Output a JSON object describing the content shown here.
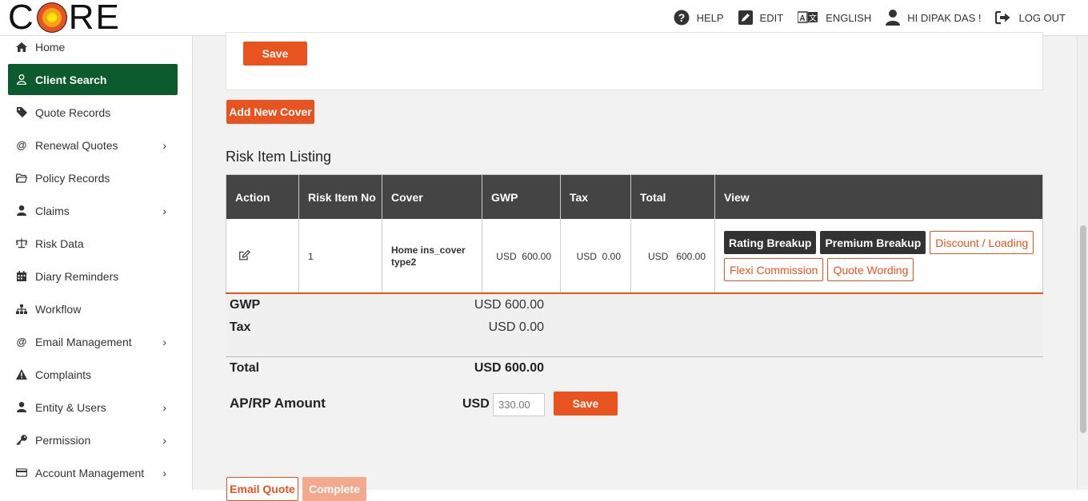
{
  "logo": {
    "text_c": "C",
    "text_re": "RE"
  },
  "topnav": {
    "help": "HELP",
    "edit": "EDIT",
    "language": "ENGLISH",
    "user": "HI DIPAK DAS !",
    "logout": "LOG OUT"
  },
  "sidebar": {
    "items": [
      {
        "label": "Home",
        "icon": "home-icon"
      },
      {
        "label": "Client Search",
        "icon": "user-icon",
        "active": true
      },
      {
        "label": "Quote Records",
        "icon": "tag-icon"
      },
      {
        "label": "Renewal Quotes",
        "icon": "at-icon",
        "submenu": true
      },
      {
        "label": "Policy Records",
        "icon": "folder-icon"
      },
      {
        "label": "Claims",
        "icon": "person-icon",
        "submenu": true
      },
      {
        "label": "Risk Data",
        "icon": "scale-icon"
      },
      {
        "label": "Diary Reminders",
        "icon": "calendar-icon"
      },
      {
        "label": "Workflow",
        "icon": "sitemap-icon"
      },
      {
        "label": "Email Management",
        "icon": "at-icon",
        "submenu": true
      },
      {
        "label": "Complaints",
        "icon": "warning-icon"
      },
      {
        "label": "Entity & Users",
        "icon": "person-icon",
        "submenu": true
      },
      {
        "label": "Permission",
        "icon": "key-icon",
        "submenu": true
      },
      {
        "label": "Account Management",
        "icon": "card-icon",
        "submenu": true
      }
    ],
    "chevron": "›"
  },
  "main": {
    "panel_save": "Save",
    "add_new_cover": "Add New Cover",
    "section_title": "Risk Item Listing",
    "table": {
      "headers": [
        "Action",
        "Risk Item No",
        "Cover",
        "GWP",
        "Tax",
        "Total",
        "View"
      ],
      "row": {
        "risk_item_no": "1",
        "cover": "Home ins_cover type2",
        "gwp": "USD  600.00",
        "tax": "USD  0.00",
        "total": "USD   600.00"
      },
      "view_buttons": {
        "rating_breakup": "Rating Breakup",
        "premium_breakup": "Premium Breakup",
        "discount_loading": "Discount / Loading",
        "flexi_commission": "Flexi Commission",
        "quote_wording": "Quote Wording"
      }
    },
    "summary": {
      "gwp_label": "GWP",
      "gwp_value": "USD 600.00",
      "tax_label": "Tax",
      "tax_value": "USD 0.00",
      "total_label": "Total",
      "total_value": "USD 600.00"
    },
    "aprp": {
      "label": "AP/RP Amount",
      "currency": "USD",
      "value": "330.00",
      "save": "Save"
    },
    "bottom": {
      "email_quote": "Email Quote",
      "complete": "Complete"
    }
  },
  "colors": {
    "accent": "#e8531f",
    "active_nav": "#0b5b2e",
    "table_header": "#444444"
  }
}
